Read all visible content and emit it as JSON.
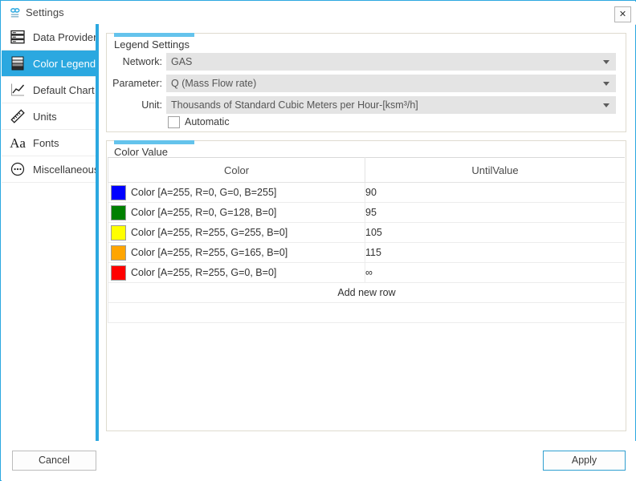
{
  "window": {
    "title": "Settings",
    "title_icon": "settings-app-icon",
    "close_label": "✕"
  },
  "sidebar": {
    "items": [
      {
        "label": "Data Provider",
        "icon": "server-icon",
        "selected": false
      },
      {
        "label": "Color Legend",
        "icon": "color-bands-icon",
        "selected": true
      },
      {
        "label": "Default Chart",
        "icon": "line-chart-icon",
        "selected": false
      },
      {
        "label": "Units",
        "icon": "ruler-icon",
        "selected": false
      },
      {
        "label": "Fonts",
        "icon": "font-aa-icon",
        "selected": false
      },
      {
        "label": "Miscellaneous",
        "icon": "ellipsis-circle-icon",
        "selected": false
      }
    ]
  },
  "legend_settings": {
    "group_title": "Legend Settings",
    "fields": [
      {
        "label": "Network:",
        "value": "GAS"
      },
      {
        "label": "Parameter:",
        "value": "Q (Mass Flow rate)"
      },
      {
        "label": "Unit:",
        "value": "Thousands of Standard Cubic Meters per Hour-[ksm³/h]"
      }
    ],
    "automatic": {
      "label": "Automatic",
      "checked": false
    }
  },
  "color_value": {
    "group_title": "Color Value",
    "columns": [
      "Color",
      "UntilValue"
    ],
    "rows": [
      {
        "swatch": "#0000FF",
        "color_text": "Color [A=255, R=0, G=0, B=255]",
        "until": "90"
      },
      {
        "swatch": "#008000",
        "color_text": "Color [A=255, R=0, G=128, B=0]",
        "until": "95"
      },
      {
        "swatch": "#FFFF00",
        "color_text": "Color [A=255, R=255, G=255, B=0]",
        "until": "105"
      },
      {
        "swatch": "#FFA500",
        "color_text": "Color [A=255, R=255, G=165, B=0]",
        "until": "115"
      },
      {
        "swatch": "#FF0000",
        "color_text": "Color [A=255, R=255, G=0, B=0]",
        "until": "∞"
      }
    ],
    "add_new_row_label": "Add new row"
  },
  "footer": {
    "cancel_label": "Cancel",
    "apply_label": "Apply"
  },
  "colors": {
    "accent": "#2ba8e0",
    "group_accent": "#64c3ec",
    "apply_border": "#2f9fd0"
  }
}
